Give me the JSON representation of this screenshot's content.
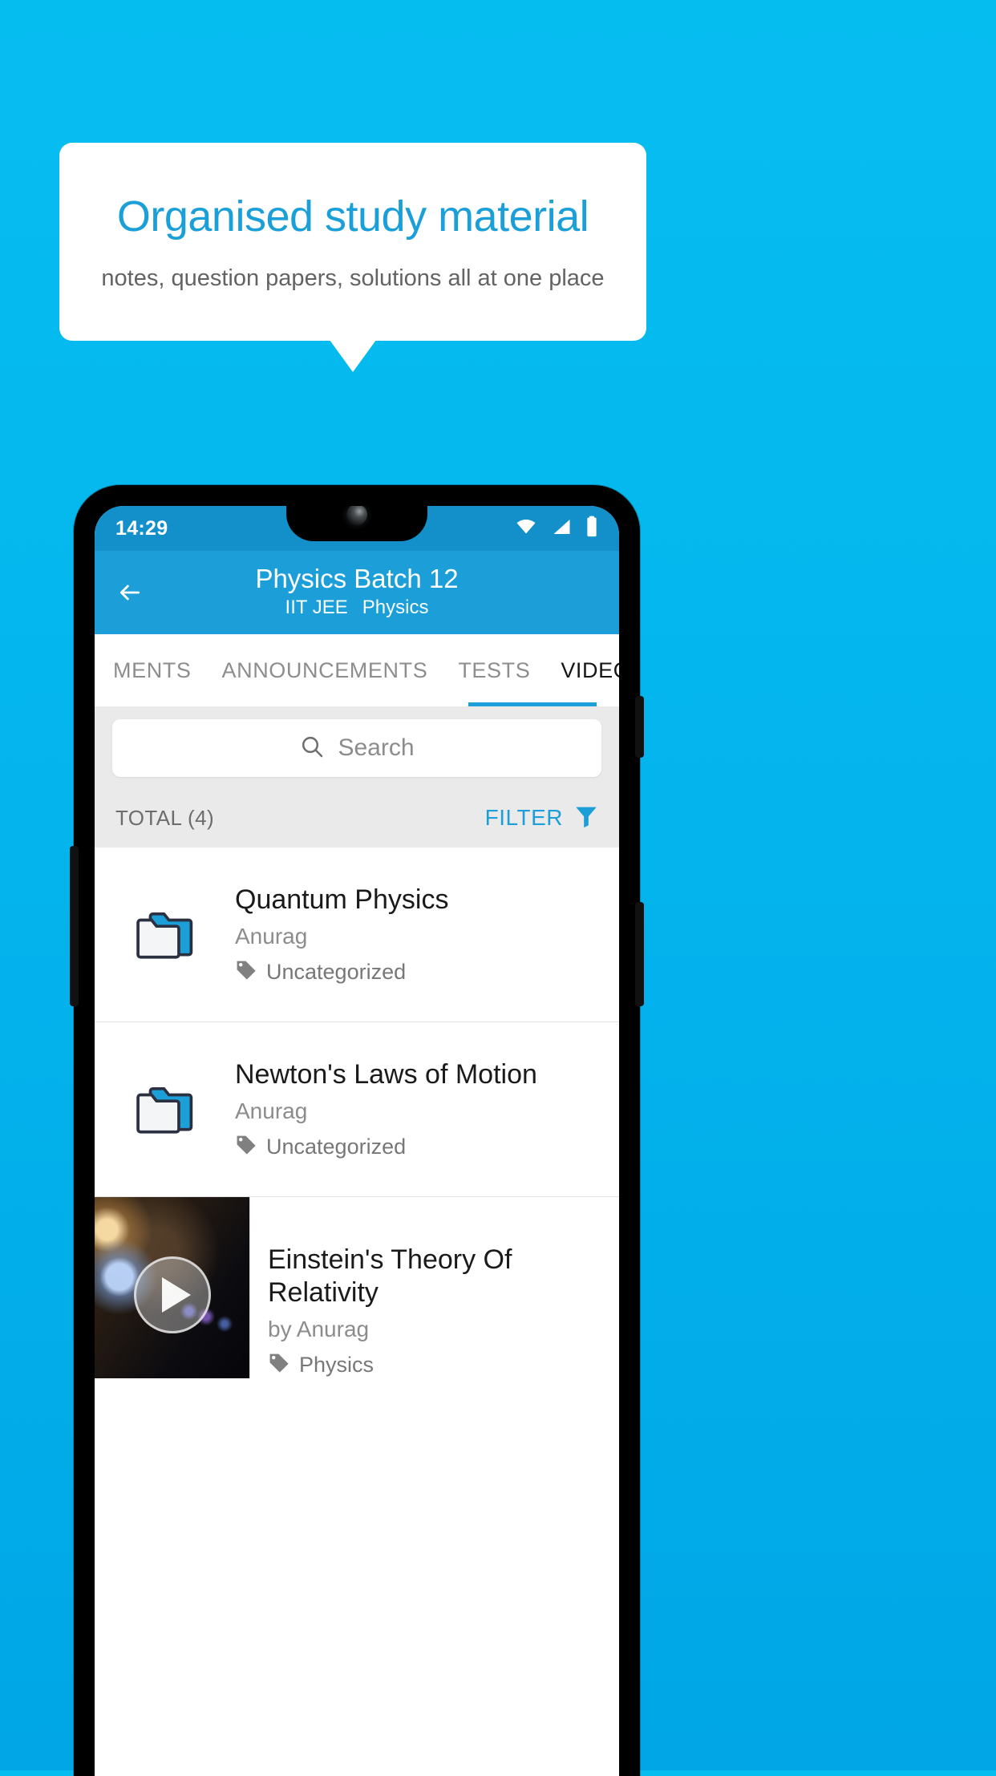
{
  "promo": {
    "title": "Organised study material",
    "subtitle": "notes, question papers, solutions all at one place"
  },
  "colors": {
    "background_top": "#06bdf0",
    "background_bottom": "#00a6e6",
    "accent": "#1c9fd8",
    "card": "#ffffff",
    "statusbar": "#1390ca"
  },
  "phone": {
    "statusbar": {
      "clock": "14:29",
      "icons": [
        "wifi-icon",
        "signal-icon",
        "battery-icon"
      ]
    },
    "appbar": {
      "back_icon": "back-arrow-icon",
      "title": "Physics Batch 12",
      "subtitle_exam": "IIT JEE",
      "subtitle_subject": "Physics"
    },
    "tabs": [
      {
        "label": "MENTS",
        "active": false
      },
      {
        "label": "ANNOUNCEMENTS",
        "active": false
      },
      {
        "label": "TESTS",
        "active": false
      },
      {
        "label": "VIDEOS",
        "active": true
      }
    ],
    "search": {
      "icon": "search-icon",
      "placeholder": "Search",
      "value": ""
    },
    "meta": {
      "total_label": "TOTAL (4)",
      "filter_label": "FILTER",
      "filter_icon": "funnel-icon"
    },
    "list": [
      {
        "type": "folder",
        "icon": "folder-icon",
        "title": "Quantum Physics",
        "author": "Anurag",
        "tag_icon": "tag-icon",
        "tag": "Uncategorized"
      },
      {
        "type": "folder",
        "icon": "folder-icon",
        "title": "Newton's Laws of Motion",
        "author": "Anurag",
        "tag_icon": "tag-icon",
        "tag": "Uncategorized"
      },
      {
        "type": "video",
        "icon": "play-icon",
        "title": "Einstein's Theory Of Relativity",
        "author": "by Anurag",
        "tag_icon": "tag-icon",
        "tag": "Physics"
      }
    ]
  }
}
